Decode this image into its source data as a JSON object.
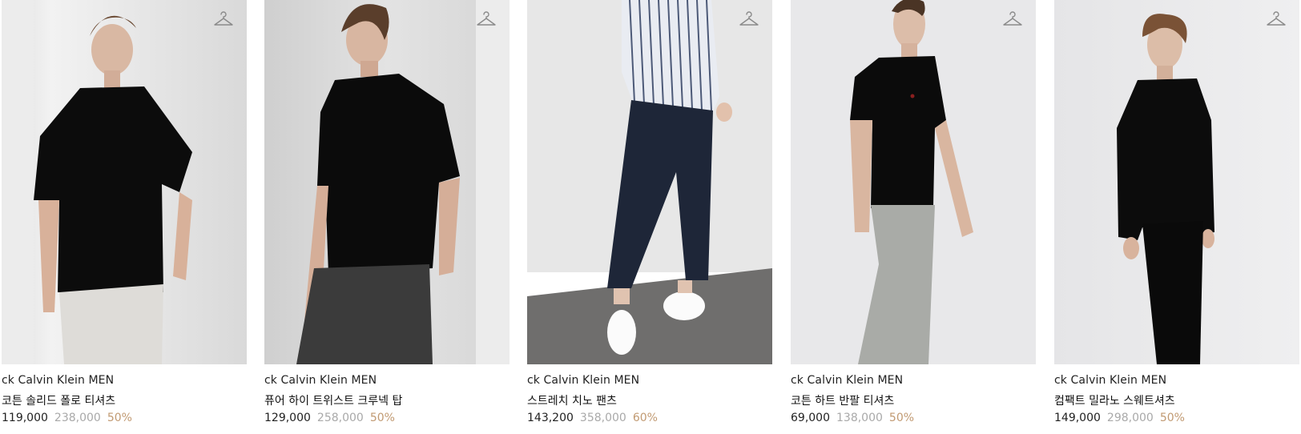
{
  "products": [
    {
      "brand": "ck Calvin Klein MEN",
      "name": "코튼 솔리드 폴로 티셔츠",
      "sale_price": "119,000",
      "original_price": "238,000",
      "discount": "50%",
      "icon": "hanger-icon"
    },
    {
      "brand": "ck Calvin Klein MEN",
      "name": "퓨어 하이 트위스트 크루넥 탑",
      "sale_price": "129,000",
      "original_price": "258,000",
      "discount": "50%",
      "icon": "hanger-icon"
    },
    {
      "brand": "ck Calvin Klein MEN",
      "name": "스트레치 치노 팬츠",
      "sale_price": "143,200",
      "original_price": "358,000",
      "discount": "60%",
      "icon": "hanger-icon"
    },
    {
      "brand": "ck Calvin Klein MEN",
      "name": "코튼 하트 반팔 티셔츠",
      "sale_price": "69,000",
      "original_price": "138,000",
      "discount": "50%",
      "icon": "hanger-icon"
    },
    {
      "brand": "ck Calvin Klein MEN",
      "name": "컴팩트 밀라노 스웨트셔츠",
      "sale_price": "149,000",
      "original_price": "298,000",
      "discount": "50%",
      "icon": "hanger-icon"
    }
  ],
  "colors": {
    "sale_price": "#222222",
    "original_price": "#a9a9a9",
    "discount": "#c19a72",
    "photo_bg": "#e8e8e8"
  }
}
